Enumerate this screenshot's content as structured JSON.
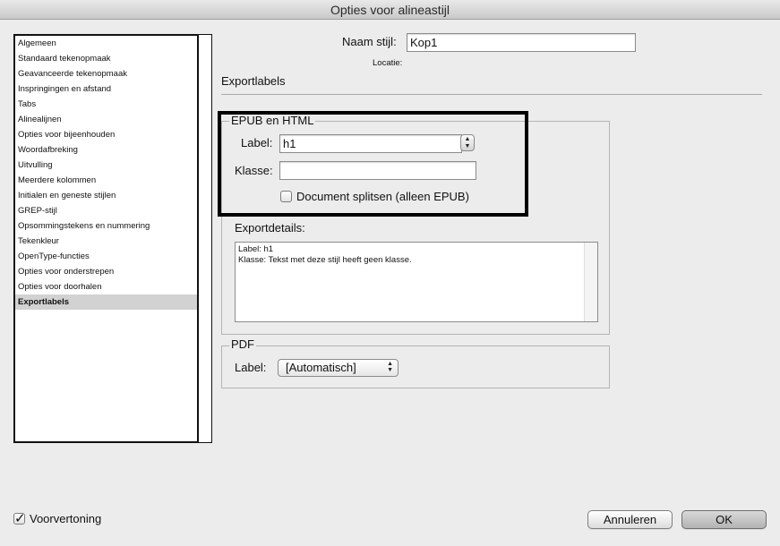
{
  "window": {
    "title": "Opties voor alineastijl"
  },
  "sidebar": {
    "items": [
      {
        "label": "Algemeen"
      },
      {
        "label": "Standaard tekenopmaak"
      },
      {
        "label": "Geavanceerde tekenopmaak"
      },
      {
        "label": "Inspringingen en afstand"
      },
      {
        "label": "Tabs"
      },
      {
        "label": "Alinealijnen"
      },
      {
        "label": "Opties voor bijeenhouden"
      },
      {
        "label": "Woordafbreking"
      },
      {
        "label": "Uitvulling"
      },
      {
        "label": "Meerdere kolommen"
      },
      {
        "label": "Initialen en geneste stijlen"
      },
      {
        "label": "GREP-stijl"
      },
      {
        "label": "Opsommingstekens en nummering"
      },
      {
        "label": "Tekenkleur"
      },
      {
        "label": "OpenType-functies"
      },
      {
        "label": "Opties voor onderstrepen"
      },
      {
        "label": "Opties voor doorhalen"
      },
      {
        "label": "Exportlabels"
      }
    ],
    "selected_index": 17
  },
  "style": {
    "name_label": "Naam stijl:",
    "name_value": "Kop1",
    "location_label": "Locatie:"
  },
  "section_title": "Exportlabels",
  "epub": {
    "title": "EPUB en HTML",
    "label_label": "Label:",
    "label_value": "h1",
    "class_label": "Klasse:",
    "class_value": "",
    "split_label": "Document splitsen (alleen EPUB)",
    "split_checked": false
  },
  "export_details": {
    "title": "Exportdetails:",
    "line1": "Label: h1",
    "line2": "Klasse: Tekst met deze stijl heeft geen klasse."
  },
  "pdf": {
    "title": "PDF",
    "label_label": "Label:",
    "label_value": "[Automatisch]"
  },
  "footer": {
    "preview_label": "Voorvertoning",
    "preview_checked": true,
    "cancel_label": "Annuleren",
    "ok_label": "OK"
  }
}
